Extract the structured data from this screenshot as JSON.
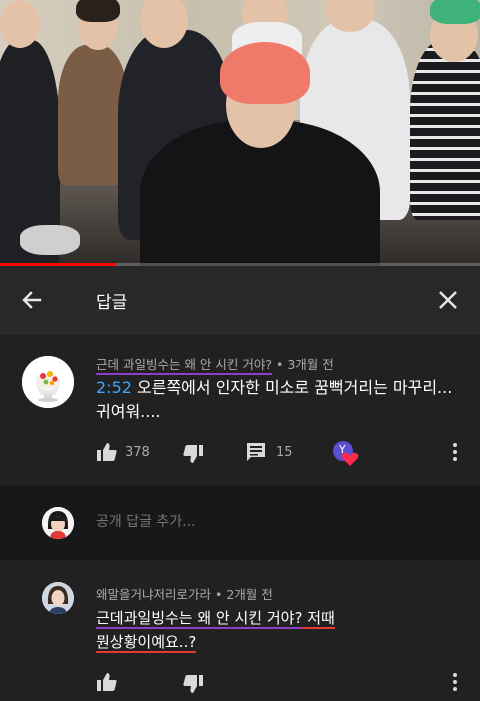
{
  "video": {
    "progress": 0.24
  },
  "header": {
    "title": "답글",
    "back_icon": "back-arrow-icon",
    "close_icon": "close-icon"
  },
  "comment": {
    "author": "근데 과일빙수는 왜 안 시킨 거야?",
    "time": " • 3개월 전",
    "timestamp_link": "2:52",
    "text": " 오른쪽에서 인자한 미소로 꿈뻑거리는 마꾸리... 귀여워....",
    "likes": "378",
    "replies": "15",
    "creator_heart_initial": "Y",
    "accent_color": "#3ea6ff"
  },
  "add_reply": {
    "placeholder": "공개 답글 추가..."
  },
  "reply": {
    "author": "왜말을거냐저리로가라",
    "time": " • 2개월 전",
    "mention": "근데과일빙수는 왜 안 시킨 거야?",
    "text_part1": " 저때",
    "text_part2": "뭔상황이예요..?"
  }
}
